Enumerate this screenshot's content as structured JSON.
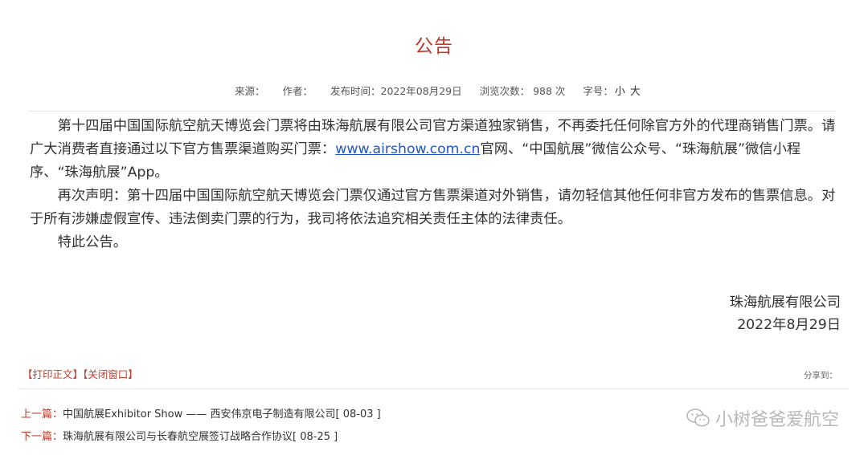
{
  "article": {
    "title": "公告",
    "meta": {
      "source": "来源：",
      "author": "作者：",
      "published": "发布时间：2022年08月29日",
      "views": "浏览次数：  988 次",
      "font_size_label": "字号：",
      "font_small": "小",
      "font_large": "大"
    },
    "paragraphs": {
      "p1_before": "第十四届中国国际航空航天博览会门票将由珠海航展有限公司官方渠道独家销售，不再委托任何除官方外的代理商销售门票。请广大消费者直接通过以下官方售票渠道购买门票：",
      "p1_link": "www.airshow.com.cn",
      "p1_after": "官网、“中国航展”微信公众号、“珠海航展”微信小程序、“珠海航展”App。",
      "p2": "再次声明：第十四届中国国际航空航天博览会门票仅通过官方售票渠道对外销售，请勿轻信其他任何非官方发布的售票信息。对于所有涉嫌虚假宣传、违法倒卖门票的行为，我司将依法追究相关责任主体的法律责任。",
      "p3": "特此公告。"
    },
    "signature": {
      "company": "珠海航展有限公司",
      "date": "2022年8月29日"
    }
  },
  "tools": {
    "print": "【打印正文】",
    "close": "【关闭窗口】",
    "share": "分享到："
  },
  "nav": {
    "prev_label": "上一篇：",
    "prev_title": "中国航展Exhibitor Show —— 西安伟京电子制造有限公司",
    "prev_date": "[ 08-03 ]",
    "next_label": "下一篇：",
    "next_title": "珠海航展有限公司与长春航空展签订战略合作协议",
    "next_date": "[ 08-25 ]"
  },
  "watermark": {
    "text": "小树爸爸爱航空",
    "icon": "wechat-icon"
  },
  "colors": {
    "accent_red": "#c0392b",
    "link_blue": "#2255cc",
    "text": "#333333"
  }
}
